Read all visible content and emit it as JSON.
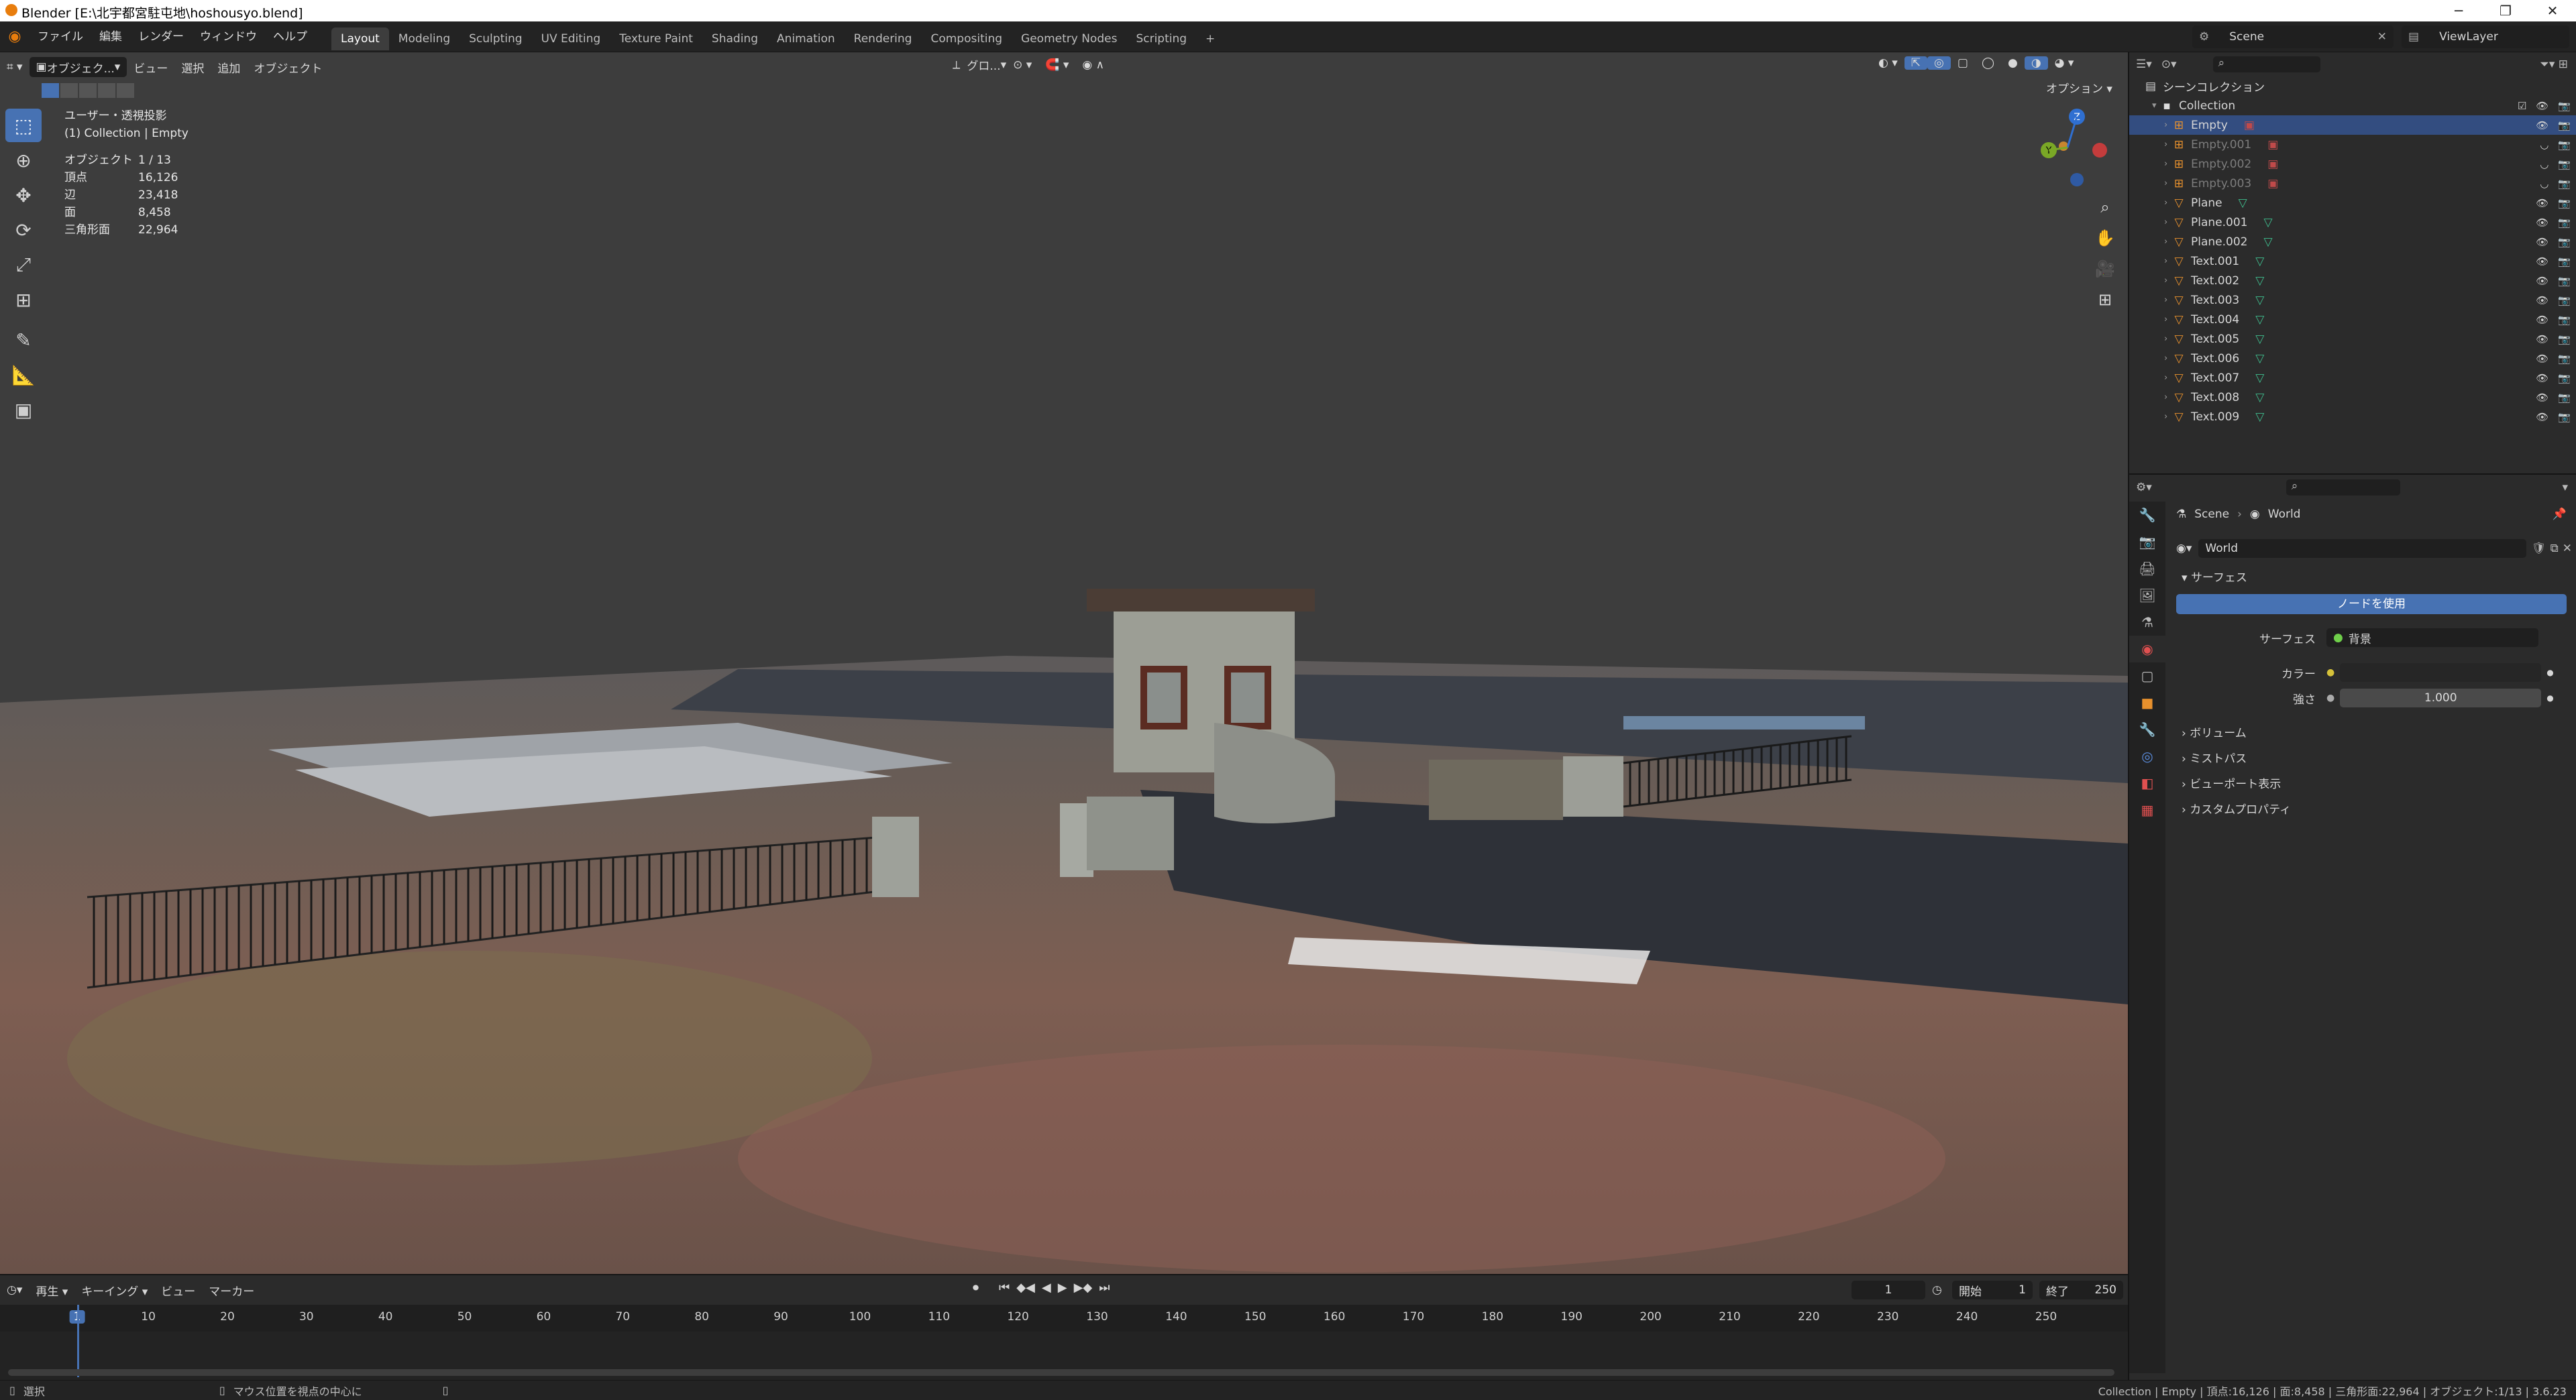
{
  "window": {
    "title": "Blender [E:\\北宇都宮駐屯地\\hoshousyo.blend]",
    "controls": [
      "─",
      "❐",
      "✕"
    ]
  },
  "menu": [
    "ファイル",
    "編集",
    "レンダー",
    "ウィンドウ",
    "ヘルプ"
  ],
  "workspaces": [
    "Layout",
    "Modeling",
    "Sculpting",
    "UV Editing",
    "Texture Paint",
    "Shading",
    "Animation",
    "Rendering",
    "Compositing",
    "Geometry Nodes",
    "Scripting"
  ],
  "scene": {
    "label": "Scene",
    "view_layer": "ViewLayer"
  },
  "viewport": {
    "mode": "オブジェク...",
    "menus": [
      "ビュー",
      "選択",
      "追加",
      "オブジェクト"
    ],
    "transform": "グロ...",
    "options": "オプション",
    "view_name": "ユーザー・透視投影",
    "collection_info": "(1) Collection | Empty",
    "stats": [
      {
        "k": "オブジェクト",
        "v": "1 / 13"
      },
      {
        "k": "頂点",
        "v": "16,126"
      },
      {
        "k": "辺",
        "v": "23,418"
      },
      {
        "k": "面",
        "v": "8,458"
      },
      {
        "k": "三角形面",
        "v": "22,964"
      }
    ],
    "gizmo": {
      "z": "Z",
      "y": "Y"
    }
  },
  "outliner": {
    "root": "シーンコレクション",
    "collection": "Collection",
    "items": [
      {
        "name": "Empty",
        "state": "selected"
      },
      {
        "name": "Empty.001",
        "state": "dim"
      },
      {
        "name": "Empty.002",
        "state": "dim"
      },
      {
        "name": "Empty.003",
        "state": "dim"
      },
      {
        "name": "Plane",
        "state": "normal"
      },
      {
        "name": "Plane.001",
        "state": "normal"
      },
      {
        "name": "Plane.002",
        "state": "normal"
      },
      {
        "name": "Text.001",
        "state": "normal"
      },
      {
        "name": "Text.002",
        "state": "normal"
      },
      {
        "name": "Text.003",
        "state": "normal"
      },
      {
        "name": "Text.004",
        "state": "normal"
      },
      {
        "name": "Text.005",
        "state": "normal"
      },
      {
        "name": "Text.006",
        "state": "normal"
      },
      {
        "name": "Text.007",
        "state": "normal"
      },
      {
        "name": "Text.008",
        "state": "normal"
      },
      {
        "name": "Text.009",
        "state": "normal"
      }
    ]
  },
  "properties": {
    "breadcrumb": [
      "Scene",
      "World"
    ],
    "world_name": "World",
    "surface_panel": "サーフェス",
    "use_nodes": "ノードを使用",
    "surface_label": "サーフェス",
    "surface_value": "背景",
    "color_label": "カラー",
    "strength_label": "強さ",
    "strength_value": "1.000",
    "collapsed_panels": [
      "ボリューム",
      "ミストパス",
      "ビューポート表示",
      "カスタムプロパティ"
    ]
  },
  "timeline": {
    "menus": [
      "再生",
      "キーイング",
      "ビュー",
      "マーカー"
    ],
    "current_frame": "1",
    "start_label": "開始",
    "start": "1",
    "end_label": "終了",
    "end": "250",
    "ticks": [
      "1",
      "10",
      "20",
      "30",
      "40",
      "50",
      "60",
      "70",
      "80",
      "90",
      "100",
      "110",
      "120",
      "130",
      "140",
      "150",
      "160",
      "170",
      "180",
      "190",
      "200",
      "210",
      "220",
      "230",
      "240",
      "250"
    ]
  },
  "status": {
    "left": "選択",
    "middle": "マウス位置を視点の中心に",
    "right": "Collection | Empty | 頂点:16,126 | 面:8,458 | 三角形面:22,964 | オブジェクト:1/13 | 3.6.23"
  },
  "colors": {
    "accent": "#4772b3",
    "selected_row": "#334d80",
    "viewport_bg": "#3d3d3d"
  }
}
